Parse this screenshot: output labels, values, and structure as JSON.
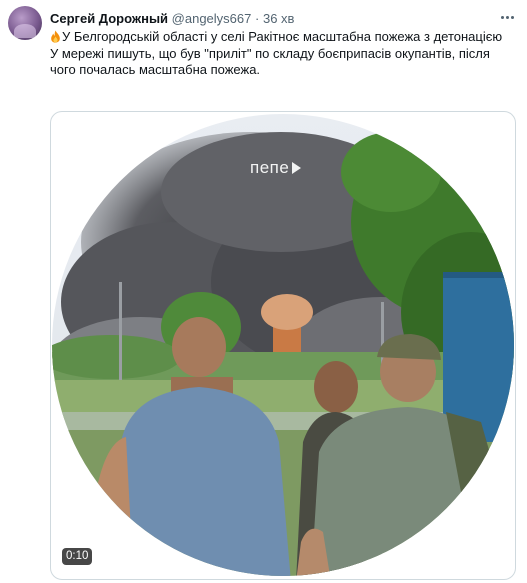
{
  "tweet": {
    "author_name": "Сергей Дорожный",
    "author_handle": "@angelys667",
    "separator": "·",
    "time": "36 хв",
    "line1": "У Белгородській області у селі Ракітноє масштабна пожежа з детонацією",
    "line2": "У мережі пишуть, що був \"приліт\" по складу боєприпасів окупантів, після чого почалась масштабна пожежа.",
    "emoji": "fire-icon"
  },
  "media": {
    "watermark": "пепе",
    "duration": "0:10"
  },
  "colors": {
    "text": "#0f1419",
    "secondary": "#536471",
    "border": "#cfd9de"
  }
}
